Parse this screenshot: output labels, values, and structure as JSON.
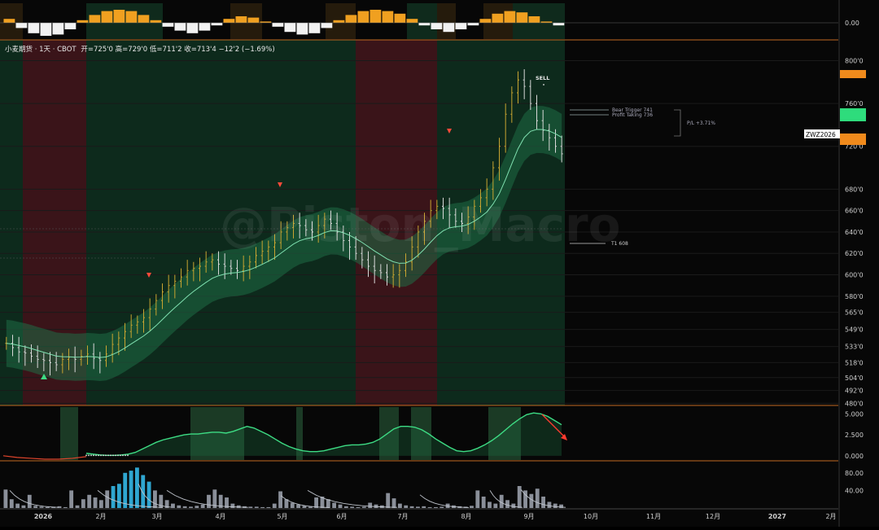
{
  "header": {
    "symbol_line": "小麦期货 · 1天 · CBOT",
    "ohlc": "开=725'0  高=729'0  低=711'2  收=713'4  −12'2 (−1.69%)"
  },
  "badges": {
    "contract": "ZWZ2026"
  },
  "annotations": {
    "sell": "SELL",
    "bear_trigger": "Bear Trigger 741",
    "profit_taking": "Profit Taking 736",
    "pl": "P/L +3.71%",
    "t1": "T1 608"
  },
  "colors": {
    "bull_bg": "#0d2a1c",
    "bear_bg": "#3a1419",
    "band": "#1f6b45",
    "accent_orange": "#f0a020",
    "up_candle": "#c8a431",
    "down_candle": "#d8d8d8",
    "oscillator_green": "#3ddc84",
    "oscillator_red": "#e0452c",
    "volume_gray": "#8a8f99",
    "volume_blue": "#2fa6d0"
  },
  "chart_data": [
    {
      "type": "bar",
      "panel": "top-histogram",
      "ylabels": [
        "0.00"
      ],
      "values": [
        0.3,
        -0.4,
        -0.8,
        -1.0,
        -0.9,
        -0.5,
        0.2,
        0.6,
        0.9,
        1.0,
        0.9,
        0.6,
        0.2,
        -0.3,
        -0.6,
        -0.8,
        -0.6,
        -0.2,
        0.3,
        0.5,
        0.4,
        0.1,
        -0.3,
        -0.7,
        -0.9,
        -0.8,
        -0.4,
        0.2,
        0.6,
        0.9,
        1.0,
        0.9,
        0.7,
        0.3,
        -0.2,
        -0.5,
        -0.7,
        -0.5,
        -0.2,
        0.3,
        0.7,
        0.9,
        0.8,
        0.5,
        0.1,
        -0.2
      ]
    },
    {
      "type": "candlestick",
      "panel": "price",
      "title": "小麦期货 · 1天 · CBOT",
      "y_ticks": [
        "800'0",
        "760'0",
        "720'0",
        "680'0",
        "660'0",
        "640'0",
        "620'0",
        "600'0",
        "580'0",
        "565'0",
        "549'0",
        "533'0",
        "518'0",
        "504'0",
        "492'0",
        "480'0"
      ],
      "x_ticks": [
        "2026",
        "2月",
        "3月",
        "4月",
        "5月",
        "6月",
        "7月",
        "8月",
        "9月",
        "10月",
        "11月",
        "12月",
        "2027",
        "2月"
      ],
      "ylim": [
        478,
        808
      ],
      "close_series": [
        536,
        532,
        528,
        527,
        524,
        521,
        520,
        518,
        516,
        521,
        523,
        521,
        524,
        526,
        522,
        520,
        526,
        535,
        541,
        547,
        553,
        556,
        560,
        568,
        576,
        584,
        590,
        594,
        598,
        604,
        606,
        608,
        612,
        614,
        610,
        608,
        606,
        604,
        608,
        612,
        618,
        622,
        626,
        630,
        640,
        644,
        648,
        646,
        642,
        640,
        646,
        652,
        648,
        640,
        632,
        626,
        620,
        614,
        608,
        604,
        602,
        598,
        600,
        604,
        612,
        626,
        640,
        650,
        660,
        664,
        662,
        656,
        650,
        648,
        654,
        664,
        672,
        680,
        700,
        720,
        750,
        770,
        782,
        776,
        760,
        744,
        735,
        728,
        720,
        713
      ],
      "events": [
        {
          "label": "▲",
          "kind": "buy-signal",
          "at": "2026-01"
        },
        {
          "label": "▼",
          "kind": "sell-signal",
          "at": "2026-03"
        },
        {
          "label": "▼",
          "kind": "sell-signal",
          "at": "2026-05"
        },
        {
          "label": "▼",
          "kind": "sell-signal",
          "at": "2026-07"
        },
        {
          "label": "SELL",
          "kind": "sell-signal",
          "at": "2026-09"
        }
      ],
      "levels": [
        {
          "label": "Bear Trigger 741",
          "value": 741
        },
        {
          "label": "Profit Taking 736",
          "value": 736
        },
        {
          "label": "T1 608",
          "value": 608
        }
      ]
    },
    {
      "type": "line",
      "panel": "oscillator",
      "y_ticks": [
        "5.000",
        "2.500",
        "0.000"
      ],
      "ylim": [
        -0.5,
        5.8
      ],
      "series": [
        {
          "values": [
            0.3,
            0.2,
            0.1,
            0.05,
            0.05,
            0.1,
            0.2,
            0.4,
            0.8,
            1.2,
            1.6,
            1.9,
            2.1,
            2.3,
            2.5,
            2.6,
            2.6,
            2.7,
            2.8,
            2.8,
            2.7,
            2.9,
            3.2,
            3.5,
            3.3,
            2.9,
            2.5,
            2.0,
            1.5,
            1.1,
            0.8,
            0.6,
            0.5,
            0.5,
            0.6,
            0.8,
            1.0,
            1.2,
            1.3,
            1.3,
            1.4,
            1.6,
            2.0,
            2.6,
            3.2,
            3.5,
            3.5,
            3.4,
            3.1,
            2.6,
            2.0,
            1.5,
            1.0,
            0.6,
            0.5,
            0.6,
            0.9,
            1.3,
            1.8,
            2.4,
            3.1,
            3.8,
            4.4,
            4.9,
            5.1,
            5.0,
            4.7,
            4.2,
            3.7
          ]
        },
        {
          "values": [
            0.0,
            -0.2,
            -0.3,
            -0.4,
            -0.4,
            -0.3,
            -0.1
          ]
        }
      ]
    },
    {
      "type": "bar",
      "panel": "volume",
      "y_ticks": [
        "80.00",
        "40.00"
      ],
      "ylim": [
        0,
        100
      ],
      "values": [
        42,
        20,
        10,
        6,
        30,
        5,
        3,
        2,
        3,
        4,
        2,
        40,
        6,
        20,
        30,
        24,
        18,
        40,
        50,
        55,
        80,
        85,
        92,
        75,
        60,
        40,
        30,
        18,
        10,
        6,
        4,
        3,
        5,
        8,
        30,
        42,
        30,
        24,
        10,
        6,
        4,
        3,
        3,
        2,
        2,
        10,
        38,
        20,
        12,
        8,
        5,
        3,
        24,
        26,
        20,
        12,
        8,
        4,
        3,
        2,
        3,
        12,
        8,
        6,
        34,
        22,
        10,
        6,
        4,
        3,
        4,
        2,
        2,
        3,
        10,
        6,
        4,
        3,
        5,
        40,
        26,
        14,
        10,
        30,
        18,
        10,
        50,
        40,
        32,
        44,
        26,
        14,
        10,
        8
      ]
    }
  ]
}
